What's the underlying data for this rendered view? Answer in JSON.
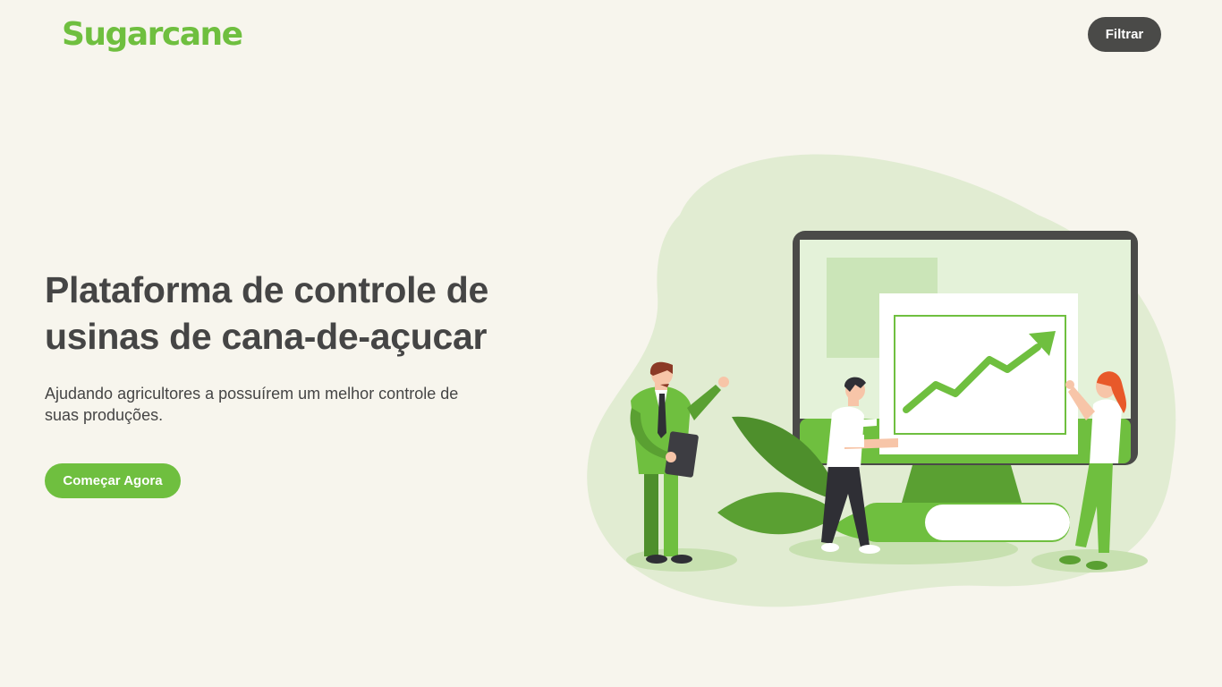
{
  "header": {
    "logo": "Sugarcane",
    "filter_label": "Filtrar"
  },
  "hero": {
    "title_line1": "Plataforma de controle de",
    "title_line2": "usinas de cana-de-açucar",
    "subtitle_line1": "Ajudando agricultores a possuírem um melhor controle de",
    "subtitle_line2": "suas produções.",
    "cta_label": "Começar Agora"
  },
  "theme": {
    "background": "#f7f5ed",
    "accent": "#6fbf3f",
    "dark_button": "#4a4a48",
    "text": "#454545"
  },
  "illustration": {
    "icon": "growth-chart-team-illustration",
    "trend": "rising"
  }
}
